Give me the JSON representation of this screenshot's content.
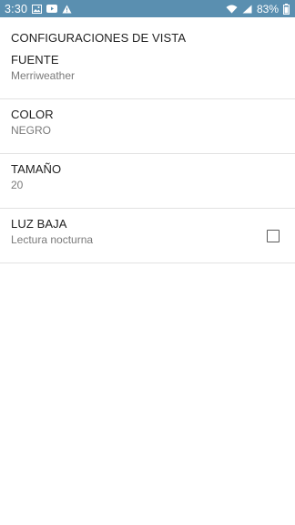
{
  "status_bar": {
    "time": "3:30",
    "icons_left": [
      "image-icon",
      "youtube-icon",
      "warning-icon"
    ],
    "icons_right": [
      "wifi-icon",
      "signal-icon",
      "battery-icon"
    ],
    "battery_percent": "83%",
    "background_color": "#5a8fb0"
  },
  "screen": {
    "title": "CONFIGURACIONES DE VISTA"
  },
  "settings": [
    {
      "title": "FUENTE",
      "summary": "Merriweather"
    },
    {
      "title": "COLOR",
      "summary": "NEGRO"
    },
    {
      "title": "TAMAÑO",
      "summary": "20"
    },
    {
      "title": "LUZ BAJA",
      "summary": "Lectura nocturna",
      "checkbox_checked": false
    }
  ]
}
